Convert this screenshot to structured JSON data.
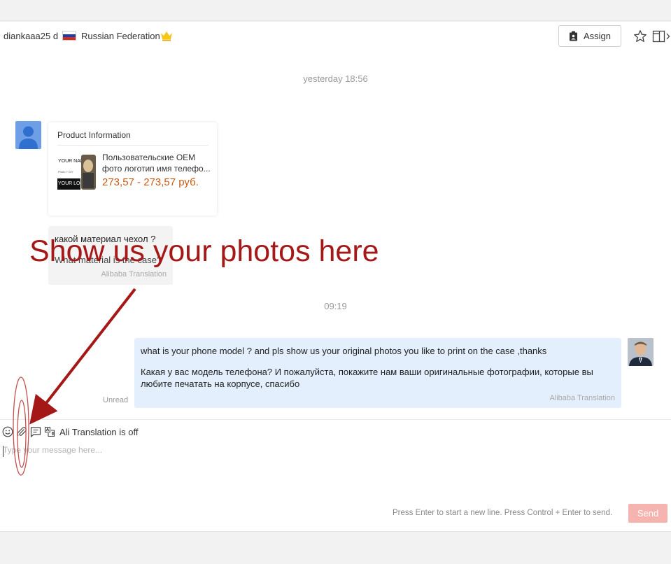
{
  "header": {
    "username": "diankaaa25 d",
    "country": "Russian Federation",
    "assign_label": "Assign"
  },
  "conversation": {
    "timestamp_1": "yesterday 18:56",
    "timestamp_2": "09:19",
    "product_card": {
      "title": "Product Information",
      "name": "Пользовательские OEM фото логотип имя телефо...",
      "price": "273,57 - 273,57 руб.",
      "thumb_text_1": "YOUR NAME",
      "thumb_text_2": "Photo + DIY",
      "thumb_text_3": "YOUR LOGO"
    },
    "incoming": {
      "original": "какой материал чехол ?",
      "translated": "What material is the case?",
      "source": "Alibaba Translation"
    },
    "outgoing": {
      "original": "what is your phone model ? and pls show us your original photos you like to print on the case ,thanks",
      "translated": "Какая у вас модель телефона? И пожалуйста, покажите нам ваши оригинальные фотографии, которые вы любите печатать на корпусе, спасибо",
      "source": "Alibaba Translation",
      "status": "Unread"
    }
  },
  "annotation": {
    "text": "Show us your photos here",
    "color": "#a51818"
  },
  "composer": {
    "translation_status": "Ali Translation is off",
    "placeholder": "Type your message here...",
    "hint": "Press Enter to start a new line. Press Control + Enter to send.",
    "send_label": "Send"
  },
  "colors": {
    "accent_price": "#c95a12",
    "bubble_out": "#e3effc",
    "bubble_in": "#f3f3f3",
    "send_disabled": "#f6b4b0",
    "crown": "#f5c518"
  },
  "icons": {
    "crown": "crown-icon",
    "assign": "assign-icon",
    "star": "star-icon",
    "layout": "layout-toggle-icon",
    "emoji": "emoji-icon",
    "attachment": "paperclip-icon",
    "quick_reply": "quick-reply-icon",
    "translate": "translate-icon"
  }
}
